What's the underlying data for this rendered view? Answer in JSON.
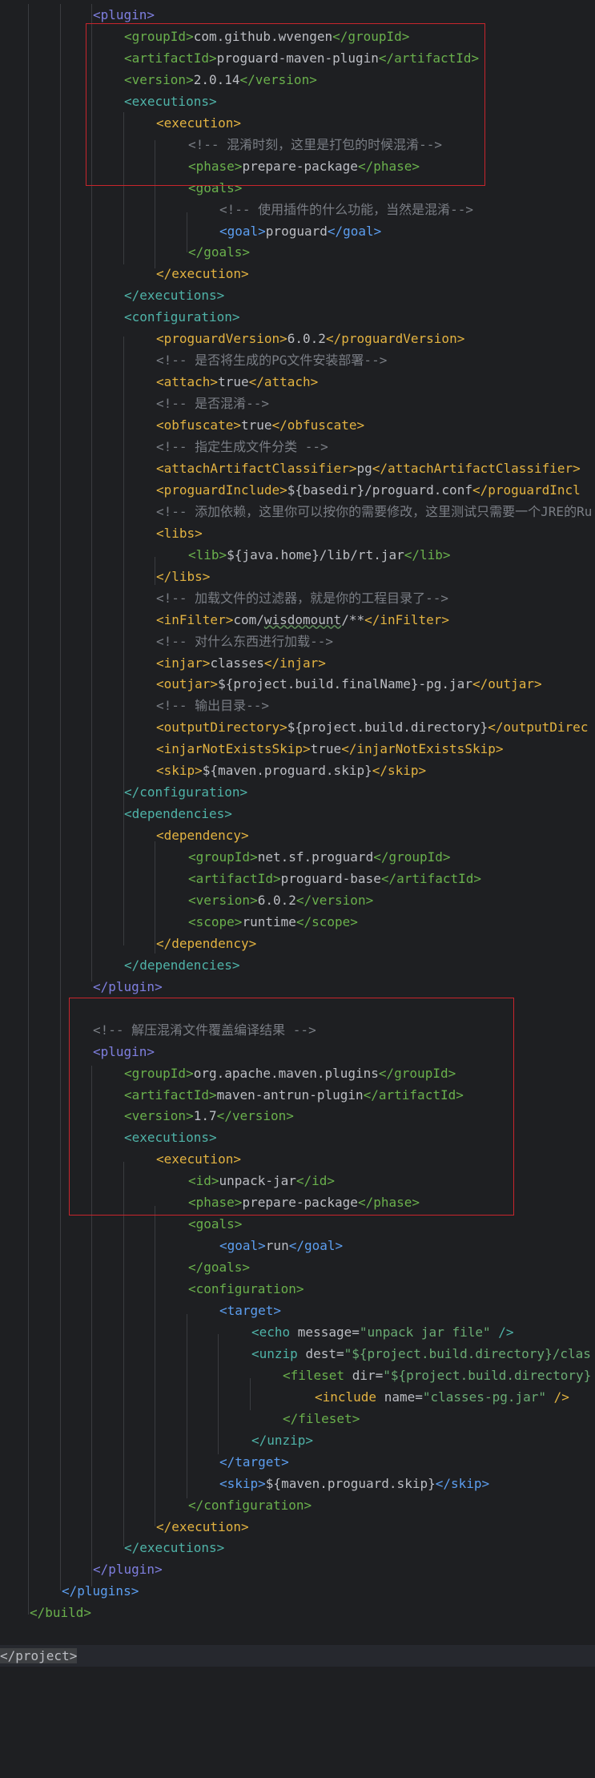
{
  "colors": {
    "background": "#1e1f22",
    "highlight_box": "#c8252c",
    "tag_teal": "#4fb3a8",
    "tag_green": "#6ab04c",
    "tag_yellow": "#e3b341",
    "tag_blue": "#5c9ef0",
    "tag_purple": "#7f7fe0",
    "comment": "#7a7e85",
    "text": "#bcbec4"
  },
  "lines": [
    {
      "tokens": [
        [
          "tp",
          "<plugin>"
        ]
      ]
    },
    {
      "tokens": [
        [
          "tg",
          "<groupId>"
        ],
        [
          "tx",
          "com.github.wvengen"
        ],
        [
          "tg",
          "</groupId>"
        ]
      ]
    },
    {
      "tokens": [
        [
          "tg",
          "<artifactId>"
        ],
        [
          "tx",
          "proguard-maven-plugin"
        ],
        [
          "tg",
          "</artifactId>"
        ]
      ]
    },
    {
      "tokens": [
        [
          "tg",
          "<version>"
        ],
        [
          "tx",
          "2.0.14"
        ],
        [
          "tg",
          "</version>"
        ]
      ]
    },
    {
      "tokens": [
        [
          "tb",
          "<executions>"
        ]
      ]
    },
    {
      "tokens": [
        [
          "ty",
          "<execution>"
        ]
      ]
    },
    {
      "tokens": [
        [
          "tc",
          "<!-- 混淆时刻，这里是打包的时候混淆-->"
        ]
      ]
    },
    {
      "tokens": [
        [
          "tg",
          "<phase>"
        ],
        [
          "tx",
          "prepare-package"
        ],
        [
          "tg",
          "</phase>"
        ]
      ]
    },
    {
      "tokens": [
        [
          "tg",
          "<goals>"
        ]
      ]
    },
    {
      "tokens": [
        [
          "tc",
          "<!-- 使用插件的什么功能，当然是混淆-->"
        ]
      ]
    },
    {
      "tokens": [
        [
          "tbl",
          "<goal>"
        ],
        [
          "tx",
          "proguard"
        ],
        [
          "tbl",
          "</goal>"
        ]
      ]
    },
    {
      "tokens": [
        [
          "tg",
          "</goals>"
        ]
      ]
    },
    {
      "tokens": [
        [
          "ty",
          "</execution>"
        ]
      ]
    },
    {
      "tokens": [
        [
          "tb",
          "</executions>"
        ]
      ]
    },
    {
      "tokens": [
        [
          "tb",
          "<configuration>"
        ]
      ]
    },
    {
      "tokens": [
        [
          "ty",
          "<proguardVersion>"
        ],
        [
          "tx",
          "6.0.2"
        ],
        [
          "ty",
          "</proguardVersion>"
        ]
      ]
    },
    {
      "tokens": [
        [
          "tc",
          "<!-- 是否将生成的PG文件安装部署-->"
        ]
      ]
    },
    {
      "tokens": [
        [
          "ty",
          "<attach>"
        ],
        [
          "tx",
          "true"
        ],
        [
          "ty",
          "</attach>"
        ]
      ]
    },
    {
      "tokens": [
        [
          "tc",
          "<!-- 是否混淆-->"
        ]
      ]
    },
    {
      "tokens": [
        [
          "ty",
          "<obfuscate>"
        ],
        [
          "tx",
          "true"
        ],
        [
          "ty",
          "</obfuscate>"
        ]
      ]
    },
    {
      "tokens": [
        [
          "tc",
          "<!-- 指定生成文件分类 -->"
        ]
      ]
    },
    {
      "tokens": [
        [
          "ty",
          "<attachArtifactClassifier>"
        ],
        [
          "tx",
          "pg"
        ],
        [
          "ty",
          "</attachArtifactClassifier>"
        ]
      ]
    },
    {
      "tokens": [
        [
          "ty",
          "<proguardInclude>"
        ],
        [
          "tx",
          "${basedir}/proguard.conf"
        ],
        [
          "ty",
          "</proguardIncl"
        ]
      ]
    },
    {
      "tokens": [
        [
          "tc",
          "<!-- 添加依赖，这里你可以按你的需要修改，这里测试只需要一个JRE的Ru"
        ]
      ]
    },
    {
      "tokens": [
        [
          "ty",
          "<libs>"
        ]
      ]
    },
    {
      "tokens": [
        [
          "tg",
          "<lib>"
        ],
        [
          "tx",
          "${java.home}/lib/rt.jar"
        ],
        [
          "tg",
          "</lib>"
        ]
      ]
    },
    {
      "tokens": [
        [
          "ty",
          "</libs>"
        ]
      ]
    },
    {
      "tokens": [
        [
          "tc",
          "<!-- 加载文件的过滤器，就是你的工程目录了-->"
        ]
      ]
    },
    {
      "tokens": [
        [
          "ty",
          "<inFilter>"
        ],
        [
          "tx",
          "com/"
        ],
        [
          "sq",
          "wisdomount"
        ],
        [
          "tx",
          "/**"
        ],
        [
          "ty",
          "</inFilter>"
        ]
      ]
    },
    {
      "tokens": [
        [
          "tc",
          "<!-- 对什么东西进行加载-->"
        ]
      ]
    },
    {
      "tokens": [
        [
          "ty",
          "<injar>"
        ],
        [
          "tx",
          "classes"
        ],
        [
          "ty",
          "</injar>"
        ]
      ]
    },
    {
      "tokens": [
        [
          "ty",
          "<outjar>"
        ],
        [
          "tx",
          "${project.build.finalName}-pg.jar"
        ],
        [
          "ty",
          "</outjar>"
        ]
      ]
    },
    {
      "tokens": [
        [
          "tc",
          "<!-- 输出目录-->"
        ]
      ]
    },
    {
      "tokens": [
        [
          "ty",
          "<outputDirectory>"
        ],
        [
          "tx",
          "${project.build.directory}"
        ],
        [
          "ty",
          "</outputDirec"
        ]
      ]
    },
    {
      "tokens": [
        [
          "ty",
          "<injarNotExistsSkip>"
        ],
        [
          "tx",
          "true"
        ],
        [
          "ty",
          "</injarNotExistsSkip>"
        ]
      ]
    },
    {
      "tokens": [
        [
          "ty",
          "<skip>"
        ],
        [
          "tx",
          "${maven.proguard.skip}"
        ],
        [
          "ty",
          "</skip>"
        ]
      ]
    },
    {
      "tokens": [
        [
          "tb",
          "</configuration>"
        ]
      ]
    },
    {
      "tokens": [
        [
          "tb",
          "<dependencies>"
        ]
      ]
    },
    {
      "tokens": [
        [
          "ty",
          "<dependency>"
        ]
      ]
    },
    {
      "tokens": [
        [
          "tg",
          "<groupId>"
        ],
        [
          "tx",
          "net.sf.proguard"
        ],
        [
          "tg",
          "</groupId>"
        ]
      ]
    },
    {
      "tokens": [
        [
          "tg",
          "<artifactId>"
        ],
        [
          "tx",
          "proguard-base"
        ],
        [
          "tg",
          "</artifactId>"
        ]
      ]
    },
    {
      "tokens": [
        [
          "tg",
          "<version>"
        ],
        [
          "tx",
          "6.0.2"
        ],
        [
          "tg",
          "</version>"
        ]
      ]
    },
    {
      "tokens": [
        [
          "tg",
          "<scope>"
        ],
        [
          "tx",
          "runtime"
        ],
        [
          "tg",
          "</scope>"
        ]
      ]
    },
    {
      "tokens": [
        [
          "ty",
          "</dependency>"
        ]
      ]
    },
    {
      "tokens": [
        [
          "tb",
          "</dependencies>"
        ]
      ]
    },
    {
      "tokens": [
        [
          "tp",
          "</plugin>"
        ]
      ]
    },
    {
      "tokens": []
    },
    {
      "tokens": [
        [
          "tc",
          "<!-- 解压混淆文件覆盖编译结果 -->"
        ]
      ]
    },
    {
      "tokens": [
        [
          "tp",
          "<plugin>"
        ]
      ]
    },
    {
      "tokens": [
        [
          "tg",
          "<groupId>"
        ],
        [
          "tx",
          "org.apache.maven.plugins"
        ],
        [
          "tg",
          "</groupId>"
        ]
      ]
    },
    {
      "tokens": [
        [
          "tg",
          "<artifactId>"
        ],
        [
          "tx",
          "maven-antrun-plugin"
        ],
        [
          "tg",
          "</artifactId>"
        ]
      ]
    },
    {
      "tokens": [
        [
          "tg",
          "<version>"
        ],
        [
          "tx",
          "1.7"
        ],
        [
          "tg",
          "</version>"
        ]
      ]
    },
    {
      "tokens": [
        [
          "tb",
          "<executions>"
        ]
      ]
    },
    {
      "tokens": [
        [
          "ty",
          "<execution>"
        ]
      ]
    },
    {
      "tokens": [
        [
          "tg",
          "<id>"
        ],
        [
          "tx",
          "unpack-jar"
        ],
        [
          "tg",
          "</id>"
        ]
      ]
    },
    {
      "tokens": [
        [
          "tg",
          "<phase>"
        ],
        [
          "tx",
          "prepare-package"
        ],
        [
          "tg",
          "</phase>"
        ]
      ]
    },
    {
      "tokens": [
        [
          "tg",
          "<goals>"
        ]
      ]
    },
    {
      "tokens": [
        [
          "tbl",
          "<goal>"
        ],
        [
          "tx",
          "run"
        ],
        [
          "tbl",
          "</goal>"
        ]
      ]
    },
    {
      "tokens": [
        [
          "tg",
          "</goals>"
        ]
      ]
    },
    {
      "tokens": [
        [
          "tg",
          "<configuration>"
        ]
      ]
    },
    {
      "tokens": [
        [
          "tbl",
          "<target>"
        ]
      ]
    },
    {
      "tokens": [
        [
          "tb",
          "<echo "
        ],
        [
          "ta",
          "message="
        ],
        [
          "tv",
          "\"unpack jar file\""
        ],
        [
          "tb",
          " />"
        ]
      ]
    },
    {
      "tokens": [
        [
          "tb",
          "<unzip "
        ],
        [
          "ta",
          "dest="
        ],
        [
          "tv",
          "\"${project.build.directory}/clas"
        ]
      ]
    },
    {
      "tokens": [
        [
          "tg",
          "<fileset "
        ],
        [
          "ta",
          "dir="
        ],
        [
          "tv",
          "\"${project.build.directory}"
        ]
      ]
    },
    {
      "tokens": [
        [
          "ty",
          "<include "
        ],
        [
          "ta",
          "name="
        ],
        [
          "tv",
          "\"classes-pg.jar\""
        ],
        [
          "ty",
          " />"
        ]
      ]
    },
    {
      "tokens": [
        [
          "tg",
          "</fileset>"
        ]
      ]
    },
    {
      "tokens": [
        [
          "tb",
          "</unzip>"
        ]
      ]
    },
    {
      "tokens": [
        [
          "tbl",
          "</target>"
        ]
      ]
    },
    {
      "tokens": [
        [
          "tbl",
          "<skip>"
        ],
        [
          "tx",
          "${maven.proguard.skip}"
        ],
        [
          "tbl",
          "</skip>"
        ]
      ]
    },
    {
      "tokens": [
        [
          "tg",
          "</configuration>"
        ]
      ]
    },
    {
      "tokens": [
        [
          "ty",
          "</execution>"
        ]
      ]
    },
    {
      "tokens": [
        [
          "tb",
          "</executions>"
        ]
      ]
    },
    {
      "tokens": [
        [
          "tp",
          "</plugin>"
        ]
      ]
    },
    {
      "tokens": [
        [
          "tbl",
          "</plugins>"
        ]
      ]
    },
    {
      "tokens": [
        [
          "tg",
          "</build>"
        ]
      ]
    },
    {
      "tokens": []
    },
    {
      "tokens": [
        [
          "hl",
          "</project>"
        ]
      ]
    }
  ]
}
